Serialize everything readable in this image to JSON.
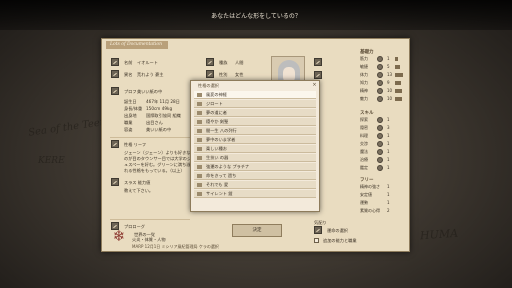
{
  "top_bar": {
    "title": "あなたはどんな形をしているの？"
  },
  "panel": {
    "tab_label": "Lots of Documentation",
    "fields": {
      "name_label": "名前",
      "name_value": "イオルート",
      "alias_label": "異名",
      "alias_value": "荒れよう 豪主",
      "race_label": "種族",
      "race_value": "人間",
      "gender_label": "性別",
      "gender_value": "女性",
      "age_label": "年齢",
      "age_value": "20歳",
      "profile_label": "プロフ",
      "birthday_label": "誕生日",
      "birthday_value": "467年 11月 28日",
      "height_label": "身長/体重",
      "height_value": "150cm 49kg",
      "hometown_label": "出身地",
      "hometown_value": "国際取引協同 組織",
      "job_label": "職業",
      "job_value": "出目さん",
      "look_label": "容姿",
      "look_value": "美いい紙の中",
      "trait_label": "性格 リーフ",
      "bio_text": "ジェーン（ジェーン）よりも好きなのが目のタウンサー目では大学のジュスペーを好む。グリーンに満ち溢れる性格をもっている。（以上）",
      "skill_label": "スラス 能力値",
      "skill_text": "教えて下さい。",
      "prologue_label": "プロローグ",
      "prologue_value": "世界の一党",
      "occupation_label": "職業",
      "occupation_value": "火炎・体質・人物",
      "footer_line": "MARP 12月1日 ミシリア風紀管理局 ケラの選択"
    },
    "stats_heading": "基礎力",
    "stats": [
      {
        "name": "筋力",
        "value": "1"
      },
      {
        "name": "敏捷",
        "value": "5"
      },
      {
        "name": "体力",
        "value": "13"
      },
      {
        "name": "知力",
        "value": "9"
      },
      {
        "name": "精神",
        "value": "10"
      },
      {
        "name": "魅力",
        "value": "10"
      }
    ],
    "skills_heading": "スキル",
    "skills": [
      {
        "name": "探索",
        "value": "1"
      },
      {
        "name": "隠密",
        "value": "3"
      },
      {
        "name": "料理",
        "value": "1"
      },
      {
        "name": "交渉",
        "value": "1"
      },
      {
        "name": "魔法",
        "value": "1"
      },
      {
        "name": "治療",
        "value": "1"
      },
      {
        "name": "鑑定",
        "value": "1"
      }
    ],
    "gauges_heading": "フリー",
    "gauges": [
      {
        "name": "精神の強さ",
        "value": "1"
      },
      {
        "name": "安定値",
        "value": "1"
      },
      {
        "name": "運勢",
        "value": "1"
      },
      {
        "name": "素質の心得",
        "value": "2"
      }
    ],
    "decide_button": "決定",
    "extra_label": "気配り",
    "extra_value": "運命の選択",
    "add_label": "追加の能力と職業"
  },
  "selector": {
    "title": "性格の選択",
    "options": [
      {
        "label": "風変の神経",
        "highlight": true
      },
      {
        "label": "ジロート",
        "highlight": false
      },
      {
        "label": "夢の道に者",
        "highlight": false
      },
      {
        "label": "穏やか 剣聖",
        "highlight": false
      },
      {
        "label": "間一生 八の列行",
        "highlight": false
      },
      {
        "label": "夢中のいま学者",
        "highlight": false
      },
      {
        "label": "楽しい種お",
        "highlight": false
      },
      {
        "label": "生技い の器",
        "highlight": false
      },
      {
        "label": "強運のような プラチナ",
        "highlight": false
      },
      {
        "label": "命をきって 過ち",
        "highlight": false
      },
      {
        "label": "それでも 愛",
        "highlight": false
      },
      {
        "label": "サイレント 鎧",
        "highlight": false
      }
    ]
  },
  "map_labels": {
    "a": "Sea of the Teeth",
    "b": "KERE",
    "c": "HUMA"
  }
}
